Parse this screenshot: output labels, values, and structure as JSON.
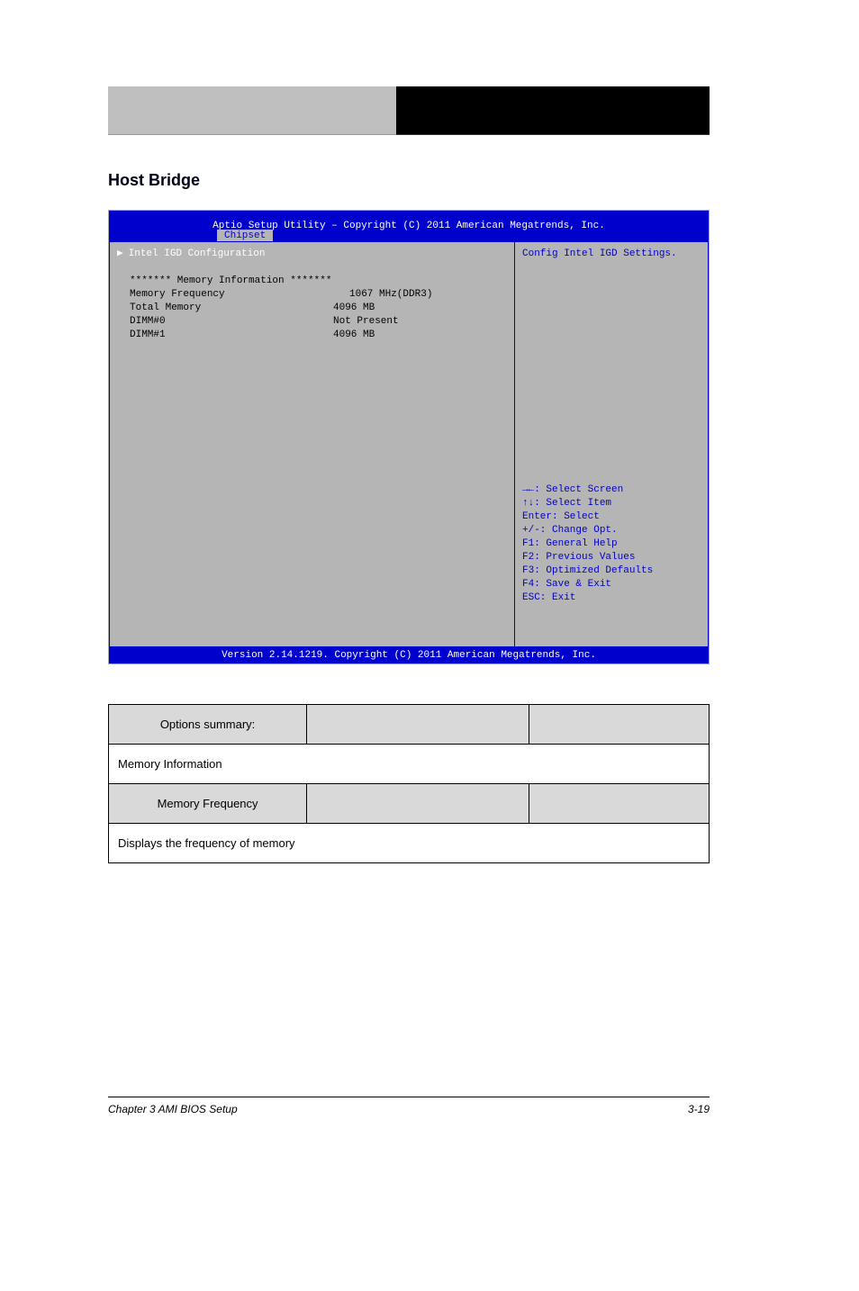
{
  "header": {
    "right_text": ""
  },
  "section_title": "Host Bridge",
  "bios": {
    "title_line": "Aptio Setup Utility – Copyright (C) 2011 American Megatrends, Inc.",
    "tab": "Chipset",
    "selected_item": "Intel IGD Configuration",
    "info_header": "******* Memory Information *******",
    "rows": [
      {
        "label": "Memory Frequency",
        "value": "1067 MHz(DDR3)"
      },
      {
        "label": "Total Memory",
        "value": "4096 MB"
      },
      {
        "label": "DIMM#0",
        "value": "Not Present"
      },
      {
        "label": "DIMM#1",
        "value": "4096 MB"
      }
    ],
    "help_text": "Config Intel IGD Settings.",
    "nav": [
      "→←: Select Screen",
      "↑↓: Select Item",
      "Enter: Select",
      "+/-: Change Opt.",
      "F1: General Help",
      "F2: Previous Values",
      "F3: Optimized Defaults",
      "F4: Save & Exit",
      "ESC: Exit"
    ],
    "footer": "Version 2.14.1219. Copyright (C) 2011 American Megatrends, Inc."
  },
  "table": {
    "headers1": [
      "Options summary:",
      "",
      ""
    ],
    "row1": "Memory Information",
    "headers2": [
      "Memory Frequency",
      "",
      ""
    ],
    "row2": "Displays the frequency of memory"
  },
  "footer": {
    "left": "Chapter 3 AMI BIOS Setup",
    "right": "3-19"
  }
}
